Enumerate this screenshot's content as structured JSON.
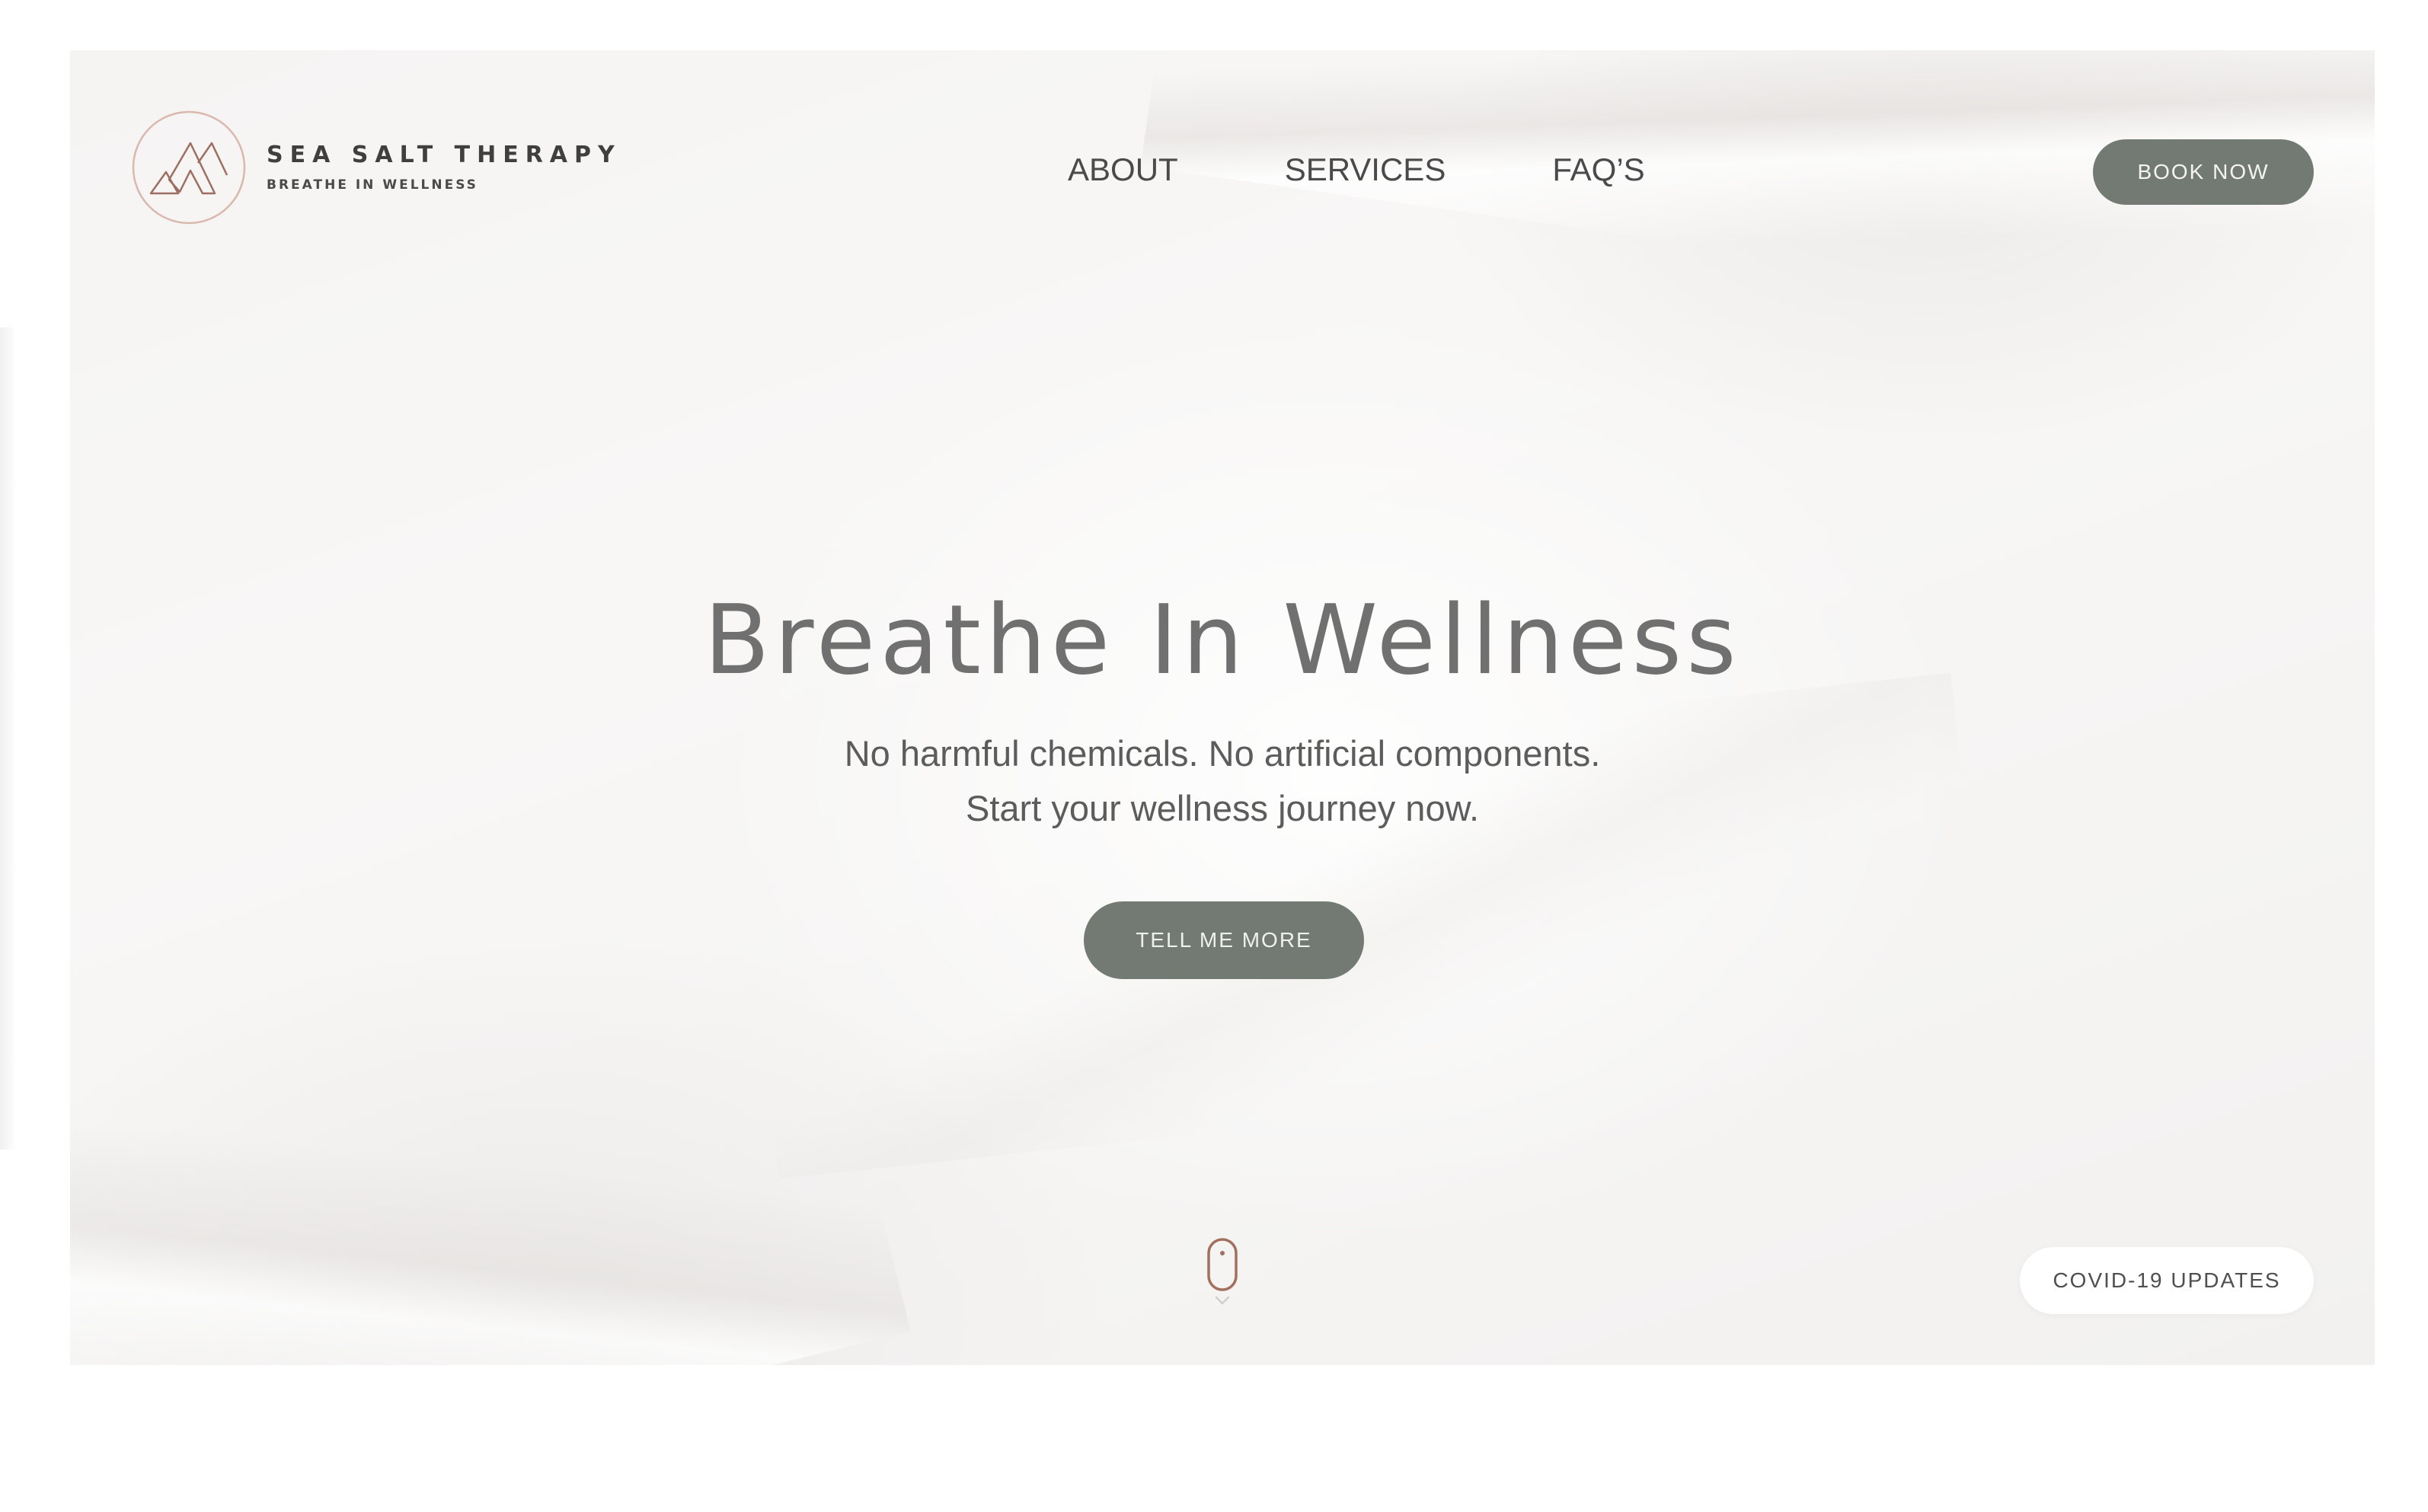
{
  "brand": {
    "name": "SEA SALT THERAPY",
    "tagline": "BREATHE IN WELLNESS",
    "logo_icon": "mountain-circle-logo-icon"
  },
  "nav": {
    "items": [
      {
        "label": "ABOUT"
      },
      {
        "label": "SERVICES"
      },
      {
        "label": "FAQ’S"
      }
    ]
  },
  "header": {
    "book_label": "BOOK NOW"
  },
  "hero": {
    "title": "Breathe In Wellness",
    "subtitle_line1": "No harmful chemicals. No artificial components.",
    "subtitle_line2": "Start your wellness journey now.",
    "cta_label": "TELL ME MORE",
    "scroll_icon": "mouse-scroll-icon"
  },
  "covid": {
    "label": "COVID-19 UPDATES"
  },
  "colors": {
    "button_bg": "#727a73",
    "button_text": "#f4f4f2",
    "logo_accent": "#b98a7a",
    "text_dark": "#4a4a4a",
    "title_gray": "#707070"
  }
}
